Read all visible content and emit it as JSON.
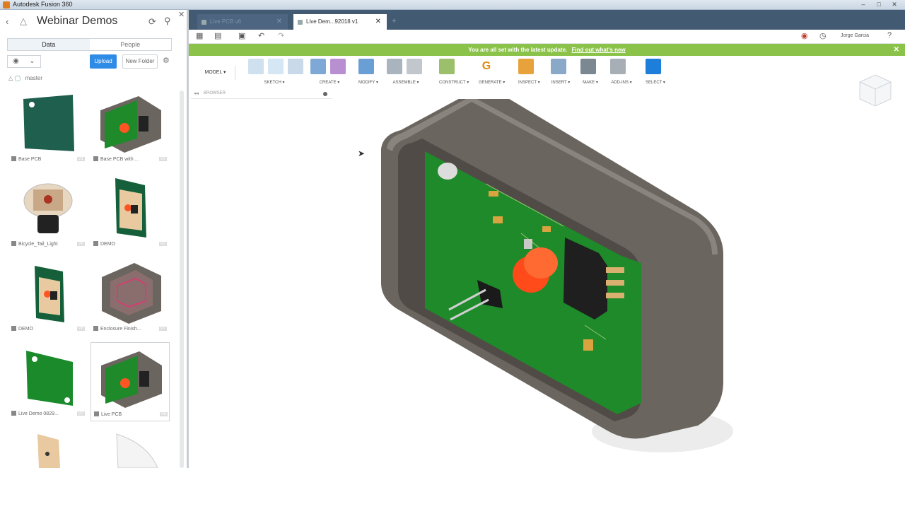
{
  "window": {
    "title": "Autodesk Fusion 360",
    "min": "–",
    "max": "□",
    "close": "✕"
  },
  "data_panel": {
    "title": "Webinar Demos",
    "tabs": [
      {
        "label": "Data"
      },
      {
        "label": "People"
      }
    ],
    "upload_label": "Upload",
    "new_folder_label": "New Folder",
    "breadcrumb": "master",
    "items": [
      {
        "label": "Base PCB",
        "version": "V1",
        "thumb": "base-pcb"
      },
      {
        "label": "Base PCB with ...",
        "version": "V5",
        "thumb": "enclosure-pcb"
      },
      {
        "label": "Bicycle_Tail_Light",
        "version": "V6",
        "thumb": "tail-light"
      },
      {
        "label": "DEMO",
        "version": "V2",
        "thumb": "demo-board"
      },
      {
        "label": "DEMO",
        "version": "V6",
        "thumb": "demo-board"
      },
      {
        "label": "Enclosure Finish...",
        "version": "V7",
        "thumb": "enclosure-finish"
      },
      {
        "label": "Live Demo 0829...",
        "version": "V2",
        "thumb": "base-pcb"
      },
      {
        "label": "Live PCB",
        "version": "V6",
        "thumb": "enclosure-pcb"
      }
    ]
  },
  "document_tabs": [
    {
      "label": "Live PCB v6",
      "active": false
    },
    {
      "label": "Live Dem...92018 v1",
      "active": true
    }
  ],
  "user": {
    "name": "Jorge Garcia"
  },
  "banner": {
    "text": "You are all set with the latest update.",
    "link": "Find out what's new"
  },
  "toolbar": {
    "workspace": "MODEL ▾",
    "groups": [
      "SKETCH ▾",
      "CREATE ▾",
      "MODIFY ▾",
      "ASSEMBLE ▾",
      "CONSTRUCT ▾",
      "GENERATE ▾",
      "INSPECT ▾",
      "INSERT ▾",
      "MAKE ▾",
      "ADD-INS ▾",
      "SELECT ▾"
    ]
  },
  "browser": {
    "label": "BROWSER"
  },
  "colors": {
    "titlebar": "#435a73",
    "banner": "#8bc34a",
    "accent": "#2e8be6",
    "pcb_green": "#1e8a2a",
    "enclosure": "#6b655f"
  }
}
